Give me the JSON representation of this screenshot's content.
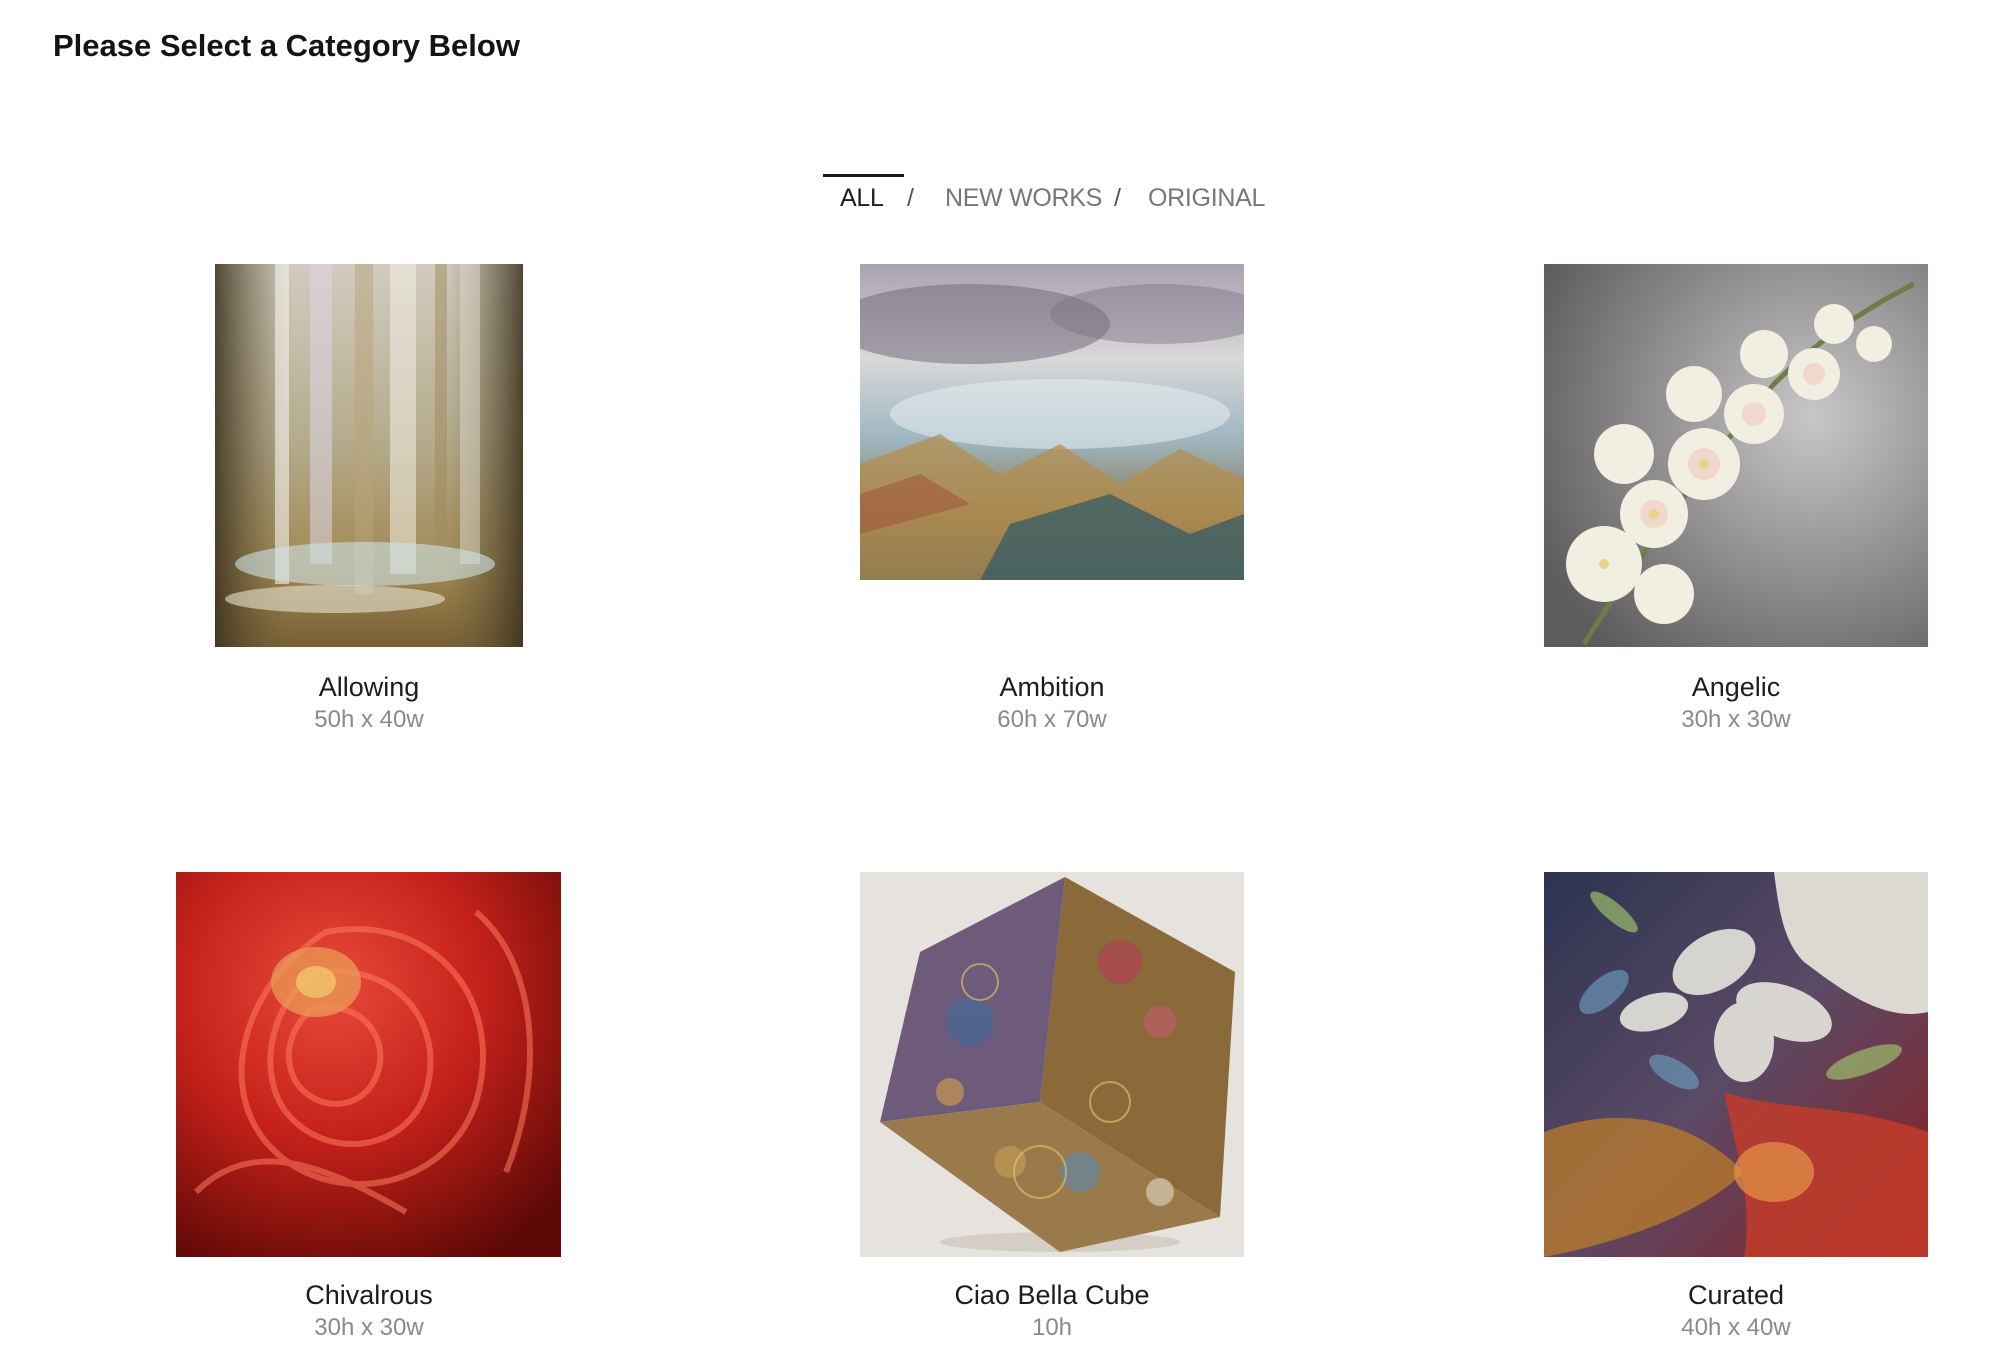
{
  "header": {
    "title": "Please Select a Category Below"
  },
  "filters": {
    "items": [
      {
        "label": "ALL",
        "active": true
      },
      {
        "label": "NEW WORKS",
        "active": false
      },
      {
        "label": "ORIGINAL",
        "active": false
      }
    ],
    "separator": "/"
  },
  "gallery": {
    "items": [
      {
        "title": "Allowing",
        "dimensions": "50h x 40w"
      },
      {
        "title": "Ambition",
        "dimensions": "60h x 70w"
      },
      {
        "title": "Angelic",
        "dimensions": "30h x 30w"
      },
      {
        "title": "Chivalrous",
        "dimensions": "30h x 30w"
      },
      {
        "title": "Ciao Bella Cube",
        "dimensions": "10h"
      },
      {
        "title": "Curated",
        "dimensions": "40h x 40w"
      }
    ]
  },
  "colors": {
    "background": "#ffffff",
    "active_filter": "#1e1e1e",
    "inactive_filter": "#777777",
    "title_text": "#1c1c1c",
    "dimensions_text": "#8a8a8a"
  }
}
